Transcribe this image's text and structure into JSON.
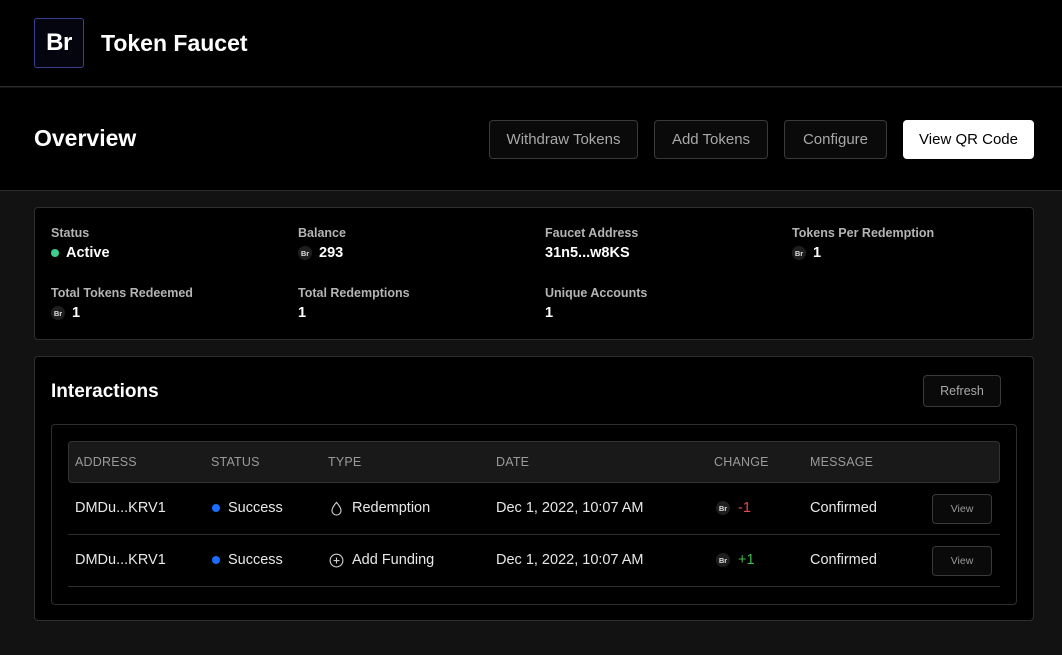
{
  "app": {
    "logo_text": "Br",
    "title": "Token Faucet"
  },
  "header": {
    "title": "Overview",
    "buttons": {
      "withdraw": "Withdraw Tokens",
      "add": "Add Tokens",
      "configure": "Configure",
      "qr": "View QR Code"
    }
  },
  "token_symbol": "Br",
  "stats": {
    "status": {
      "label": "Status",
      "value": "Active",
      "color": "#3ecf8e"
    },
    "balance": {
      "label": "Balance",
      "value": "293"
    },
    "faucet_address": {
      "label": "Faucet Address",
      "value": "31n5...w8KS"
    },
    "tokens_per_redemption": {
      "label": "Tokens Per Redemption",
      "value": "1"
    },
    "total_tokens_redeemed": {
      "label": "Total Tokens Redeemed",
      "value": "1"
    },
    "total_redemptions": {
      "label": "Total Redemptions",
      "value": "1"
    },
    "unique_accounts": {
      "label": "Unique Accounts",
      "value": "1"
    }
  },
  "interactions": {
    "title": "Interactions",
    "refresh_label": "Refresh",
    "columns": {
      "address": "ADDRESS",
      "status": "STATUS",
      "type": "TYPE",
      "date": "DATE",
      "change": "CHANGE",
      "message": "MESSAGE"
    },
    "rows": [
      {
        "address": "DMDu...KRV1",
        "status": "Success",
        "type": "Redemption",
        "type_icon": "droplet-icon",
        "date": "Dec 1, 2022, 10:07 AM",
        "change": "-1",
        "message": "Confirmed",
        "view_label": "View"
      },
      {
        "address": "DMDu...KRV1",
        "status": "Success",
        "type": "Add Funding",
        "type_icon": "plus-circle-icon",
        "date": "Dec 1, 2022, 10:07 AM",
        "change": "+1",
        "message": "Confirmed",
        "view_label": "View"
      }
    ]
  },
  "colors": {
    "success_dot": "#1a6dff",
    "negative_change": "#e5484d",
    "positive_change": "#3fb950",
    "active_dot": "#3ecf8e"
  }
}
